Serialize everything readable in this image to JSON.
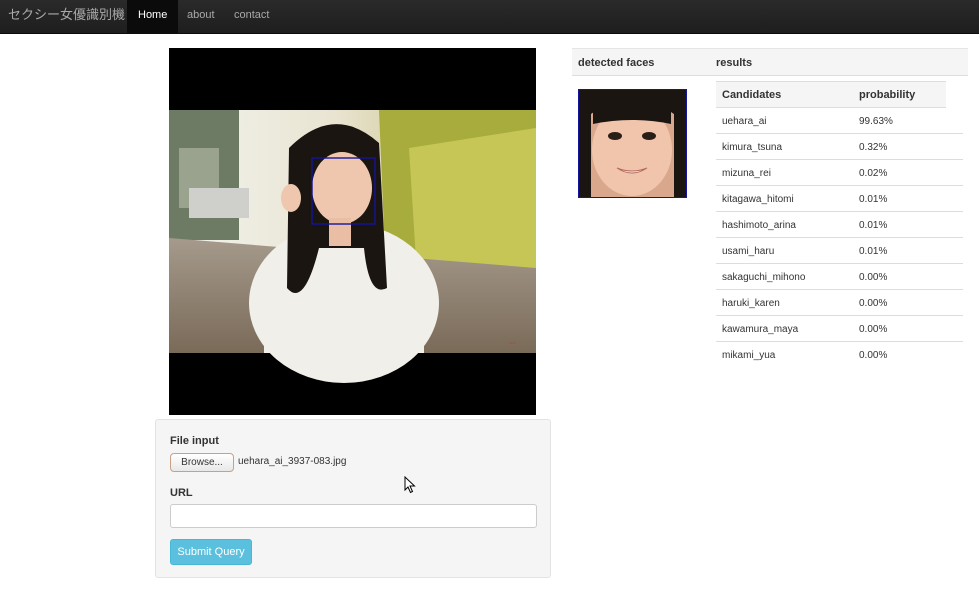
{
  "navbar": {
    "brand": "セクシー女優識別機",
    "items": [
      {
        "label": "Home",
        "active": true
      },
      {
        "label": "about",
        "active": false
      },
      {
        "label": "contact",
        "active": false
      }
    ]
  },
  "form": {
    "file_label": "File input",
    "browse_label": "Browse...",
    "file_name": "uehara_ai_3937-083.jpg",
    "url_label": "URL",
    "url_value": "",
    "url_placeholder": "",
    "submit_label": "Submit Query"
  },
  "results": {
    "detected_header": "detected faces",
    "results_header": "results",
    "table": {
      "col_candidate": "Candidates",
      "col_probability": "probability",
      "rows": [
        {
          "name": "uehara_ai",
          "prob": "99.63%"
        },
        {
          "name": "kimura_tsuna",
          "prob": "0.32%"
        },
        {
          "name": "mizuna_rei",
          "prob": "0.02%"
        },
        {
          "name": "kitagawa_hitomi",
          "prob": "0.01%"
        },
        {
          "name": "hashimoto_arina",
          "prob": "0.01%"
        },
        {
          "name": "usami_haru",
          "prob": "0.01%"
        },
        {
          "name": "sakaguchi_mihono",
          "prob": "0.00%"
        },
        {
          "name": "haruki_karen",
          "prob": "0.00%"
        },
        {
          "name": "kawamura_maya",
          "prob": "0.00%"
        },
        {
          "name": "mikami_yua",
          "prob": "0.00%"
        }
      ]
    }
  },
  "colors": {
    "navbar_bg": "#222222",
    "submit_bg": "#5bc0de",
    "face_box": "#14149c"
  }
}
